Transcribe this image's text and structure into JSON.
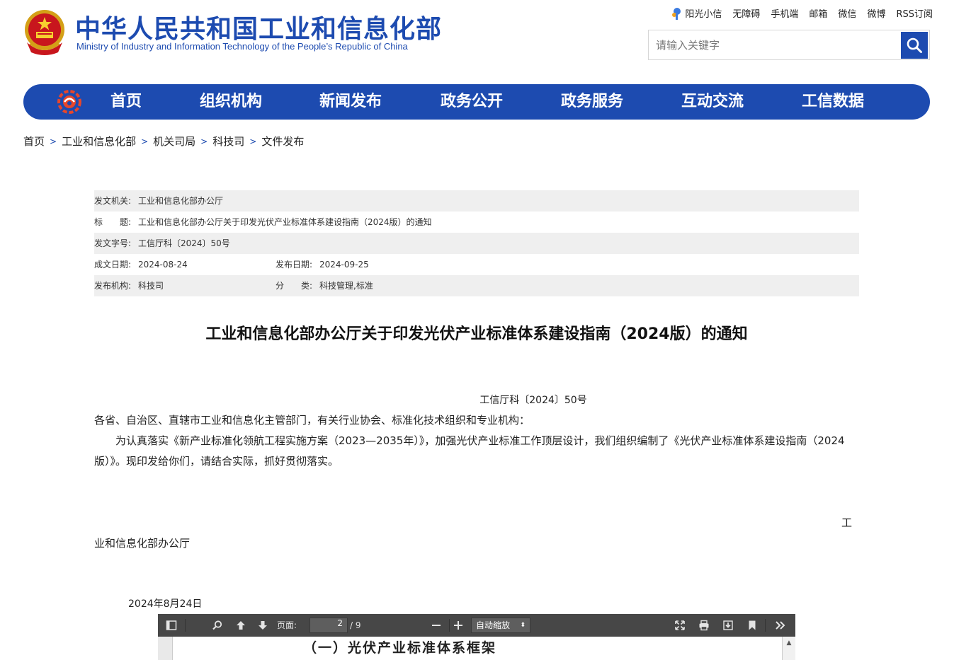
{
  "header": {
    "site_title": "中华人民共和国工业和信息化部",
    "site_subtitle": "Ministry of Industry and Information Technology of the People’s Republic of China",
    "top_links": [
      "阳光小信",
      "无障碍",
      "手机端",
      "邮箱",
      "微信",
      "微博",
      "RSS订阅"
    ],
    "search": {
      "placeholder": "请输入关键字",
      "value": ""
    }
  },
  "nav": {
    "items": [
      "首页",
      "组织机构",
      "新闻发布",
      "政务公开",
      "政务服务",
      "互动交流",
      "工信数据"
    ]
  },
  "breadcrumb": [
    "首页",
    "工业和信息化部",
    "机关司局",
    "科技司",
    "文件发布"
  ],
  "breadcrumb_separator": ">",
  "meta": {
    "issuer_label": "发文机关:",
    "issuer": "工业和信息化部办公厅",
    "title_label": "标　　题:",
    "title": "工业和信息化部办公厅关于印发光伏产业标准体系建设指南（2024版）的通知",
    "docno_label": "发文字号:",
    "docno": "工信厅科〔2024〕50号",
    "written_label": "成文日期:",
    "written": "2024-08-24",
    "published_label": "发布日期:",
    "published": "2024-09-25",
    "org_label": "发布机构:",
    "org": "科技司",
    "category_label": "分　　类:",
    "category": "科技管理,标准"
  },
  "article": {
    "title": "工业和信息化部办公厅关于印发光伏产业标准体系建设指南（2024版）的通知",
    "doc_number": "工信厅科〔2024〕50号",
    "recipients": "各省、自治区、直辖市工业和信息化主管部门，有关行业协会、标准化技术组织和专业机构：",
    "body": "　　为认真落实《新产业标准化领航工程实施方案（2023—2035年）》，加强光伏产业标准工作顶层设计，我们组织编制了《光伏产业标准体系建设指南（2024版）》。现印发给你们，请结合实际，抓好贯彻落实。",
    "signer_part1": "工",
    "signer_part2": "业和信息化部办公厅",
    "date": "2024年8月24日"
  },
  "pdf_viewer": {
    "page_label": "页面:",
    "current_page": "2",
    "total_pages": "/ 9",
    "zoom": "自动缩放",
    "page_heading": "（一）光伏产业标准体系框架"
  },
  "colors": {
    "brand_blue": "#1d4bb0",
    "meta_shade": "#efefef",
    "pdf_toolbar": "#474747"
  },
  "icons": [
    "national-emblem-icon",
    "sunshine-icon",
    "search-icon",
    "miit-logo-icon",
    "sidebar-toggle-icon",
    "find-icon",
    "prev-page-icon",
    "next-page-icon",
    "zoom-out-icon",
    "zoom-in-icon",
    "fullscreen-icon",
    "print-icon",
    "download-icon",
    "bookmark-icon",
    "more-tools-icon"
  ]
}
